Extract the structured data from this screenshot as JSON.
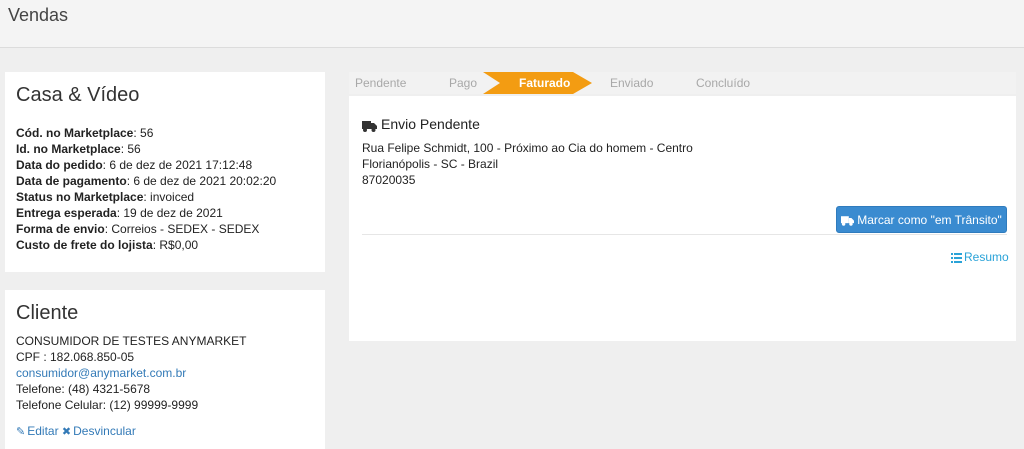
{
  "page": {
    "title": "Vendas"
  },
  "order": {
    "store": "Casa & Vídeo",
    "fields": [
      {
        "label": "Cód. no Marketplace",
        "value": ": 56"
      },
      {
        "label": "Id. no Marketplace",
        "value": ": 56"
      },
      {
        "label": "Data do pedido",
        "value": ": 6 de dez de 2021 17:12:48"
      },
      {
        "label": "Data de pagamento",
        "value": ": 6 de dez de 2021 20:02:20"
      },
      {
        "label": "Status no Marketplace",
        "value": ": invoiced"
      },
      {
        "label": "Entrega esperada",
        "value": ": 19 de dez de 2021"
      },
      {
        "label": "Forma de envio",
        "value": ": Correios - SEDEX - SEDEX"
      },
      {
        "label": "Custo de frete do lojista",
        "value": ": R$0,00"
      }
    ]
  },
  "client": {
    "title": "Cliente",
    "name": "CONSUMIDOR DE TESTES ANYMARKET",
    "cpf": "CPF : 182.068.850-05",
    "email": "consumidor@anymarket.com.br",
    "phone": "Telefone: (48) 4321-5678",
    "mobile": "Telefone Celular: (12) 99999-9999",
    "edit_label": "Editar",
    "unlink_label": "Desvincular"
  },
  "steps": {
    "items": [
      "Pendente",
      "Pago",
      "Faturado",
      "Enviado",
      "Concluído"
    ],
    "active": "Faturado",
    "active_color": "#f39c12"
  },
  "shipping": {
    "title": "Envio Pendente",
    "address_line1": "Rua Felipe Schmidt, 100 - Próximo ao Cia do homem - Centro",
    "address_line2": "Florianópolis - SC - Brazil",
    "zip": "87020035",
    "transit_button": "Marcar como \"em Trânsito\"",
    "summary_link": "Resumo",
    "button_color": "#3a8bd0"
  }
}
